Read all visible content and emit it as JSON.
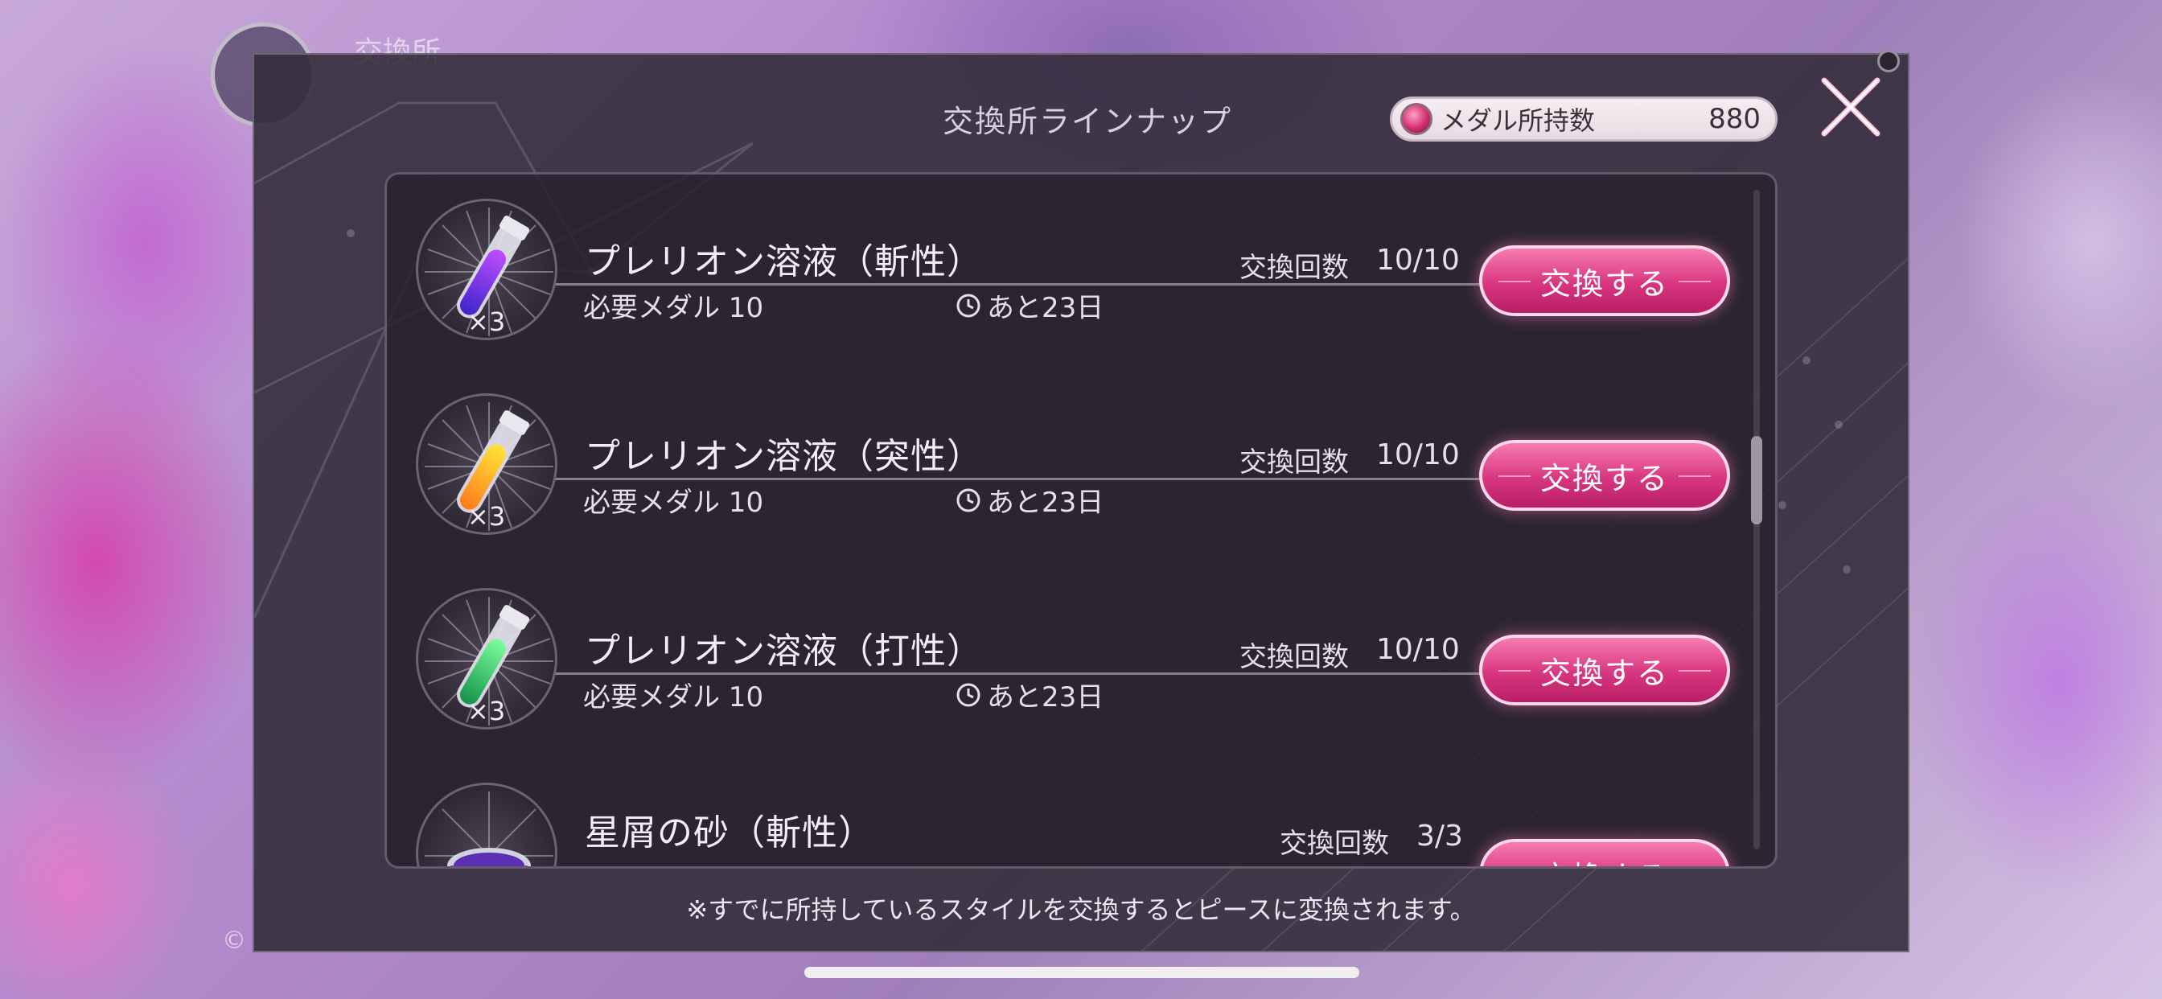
{
  "background": {
    "back_label": "交換所",
    "copyright": "©"
  },
  "modal": {
    "title": "交換所ラインナップ",
    "medal_counter": {
      "label": "メダル所持数",
      "value": "880"
    },
    "footer_note": "※すでに所持しているスタイルを交換するとピースに変換されます。",
    "items": [
      {
        "name": "プレリオン溶液（斬性）",
        "cost": "必要メダル 10",
        "timer": "あと23日",
        "count_label": "交換回数",
        "count": "10/10",
        "quantity": "×3",
        "button": "交換する",
        "icon": "purple-vial-icon",
        "colors": [
          "#6a3cff",
          "#c04dff"
        ]
      },
      {
        "name": "プレリオン溶液（突性）",
        "cost": "必要メダル 10",
        "timer": "あと23日",
        "count_label": "交換回数",
        "count": "10/10",
        "quantity": "×3",
        "button": "交換する",
        "icon": "yellow-vial-icon",
        "colors": [
          "#ffd21a",
          "#ff8a1a"
        ]
      },
      {
        "name": "プレリオン溶液（打性）",
        "cost": "必要メダル 10",
        "timer": "あと23日",
        "count_label": "交換回数",
        "count": "10/10",
        "quantity": "×3",
        "button": "交換する",
        "icon": "green-vial-icon",
        "colors": [
          "#2fe07a",
          "#1a9a4a"
        ]
      },
      {
        "name": "星屑の砂（斬性）",
        "count_label": "交換回数",
        "count": "3/3",
        "button": "交換する",
        "icon": "stardust-jar-icon"
      }
    ]
  },
  "colors": {
    "accent": "#d8367f",
    "panel": "#342e3c"
  }
}
